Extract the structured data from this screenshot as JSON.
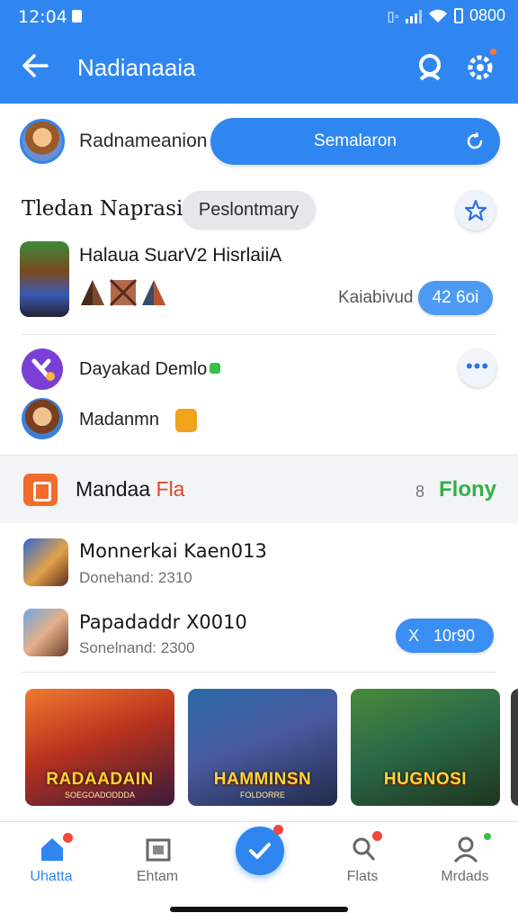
{
  "status_bar": {
    "time": "12:04",
    "right_text": "0800"
  },
  "header": {
    "title": "Nadianaaia"
  },
  "profile": {
    "name": "Radnameanion",
    "primary_button": "Semalaron"
  },
  "section": {
    "title": "Tledan Naprasii",
    "chip": "Peslontmary"
  },
  "featured_game": {
    "title": "Halaua SuarV2 HisrlaiiA",
    "meta": "Kaiabivud",
    "count": "42 6oi"
  },
  "friends": [
    {
      "name": "Dayakad Demlo"
    },
    {
      "name": "Madanmn"
    }
  ],
  "band": {
    "title_main": "Mandaa ",
    "title_accent": "Fla",
    "small": "8",
    "green": "Flony"
  },
  "list": [
    {
      "title": "Monnerkai Kaen013",
      "subtitle": "Donehand: 2310"
    },
    {
      "title": "Papadaddr X0010",
      "subtitle": "Sonelnand: 2300",
      "pill_icon": "X",
      "pill_value": "10r90"
    }
  ],
  "banners": [
    {
      "title": "RADAADAIN",
      "subtitle": "SOEGOADODDDA"
    },
    {
      "title": "HAMMINSN",
      "subtitle": "FOLDORRE"
    },
    {
      "title": "HUGNOSI",
      "subtitle": ""
    }
  ],
  "nav": [
    {
      "label": "Uhatta"
    },
    {
      "label": "Ehtam"
    },
    {
      "label": "Flats"
    },
    {
      "label": "Mrdads"
    }
  ],
  "colors": {
    "primary": "#2f86f0",
    "accent_orange": "#f26b2a",
    "accent_green": "#2fb14a",
    "notification_red": "#f0483e"
  },
  "icons": {
    "back": "arrow-left-icon",
    "header_a": "profile-icon",
    "header_b": "settings-gear-icon",
    "primary_button": "refresh-icon",
    "section_action": "star-icon",
    "more": "more-dots-icon",
    "fab": "checkmark-icon"
  }
}
